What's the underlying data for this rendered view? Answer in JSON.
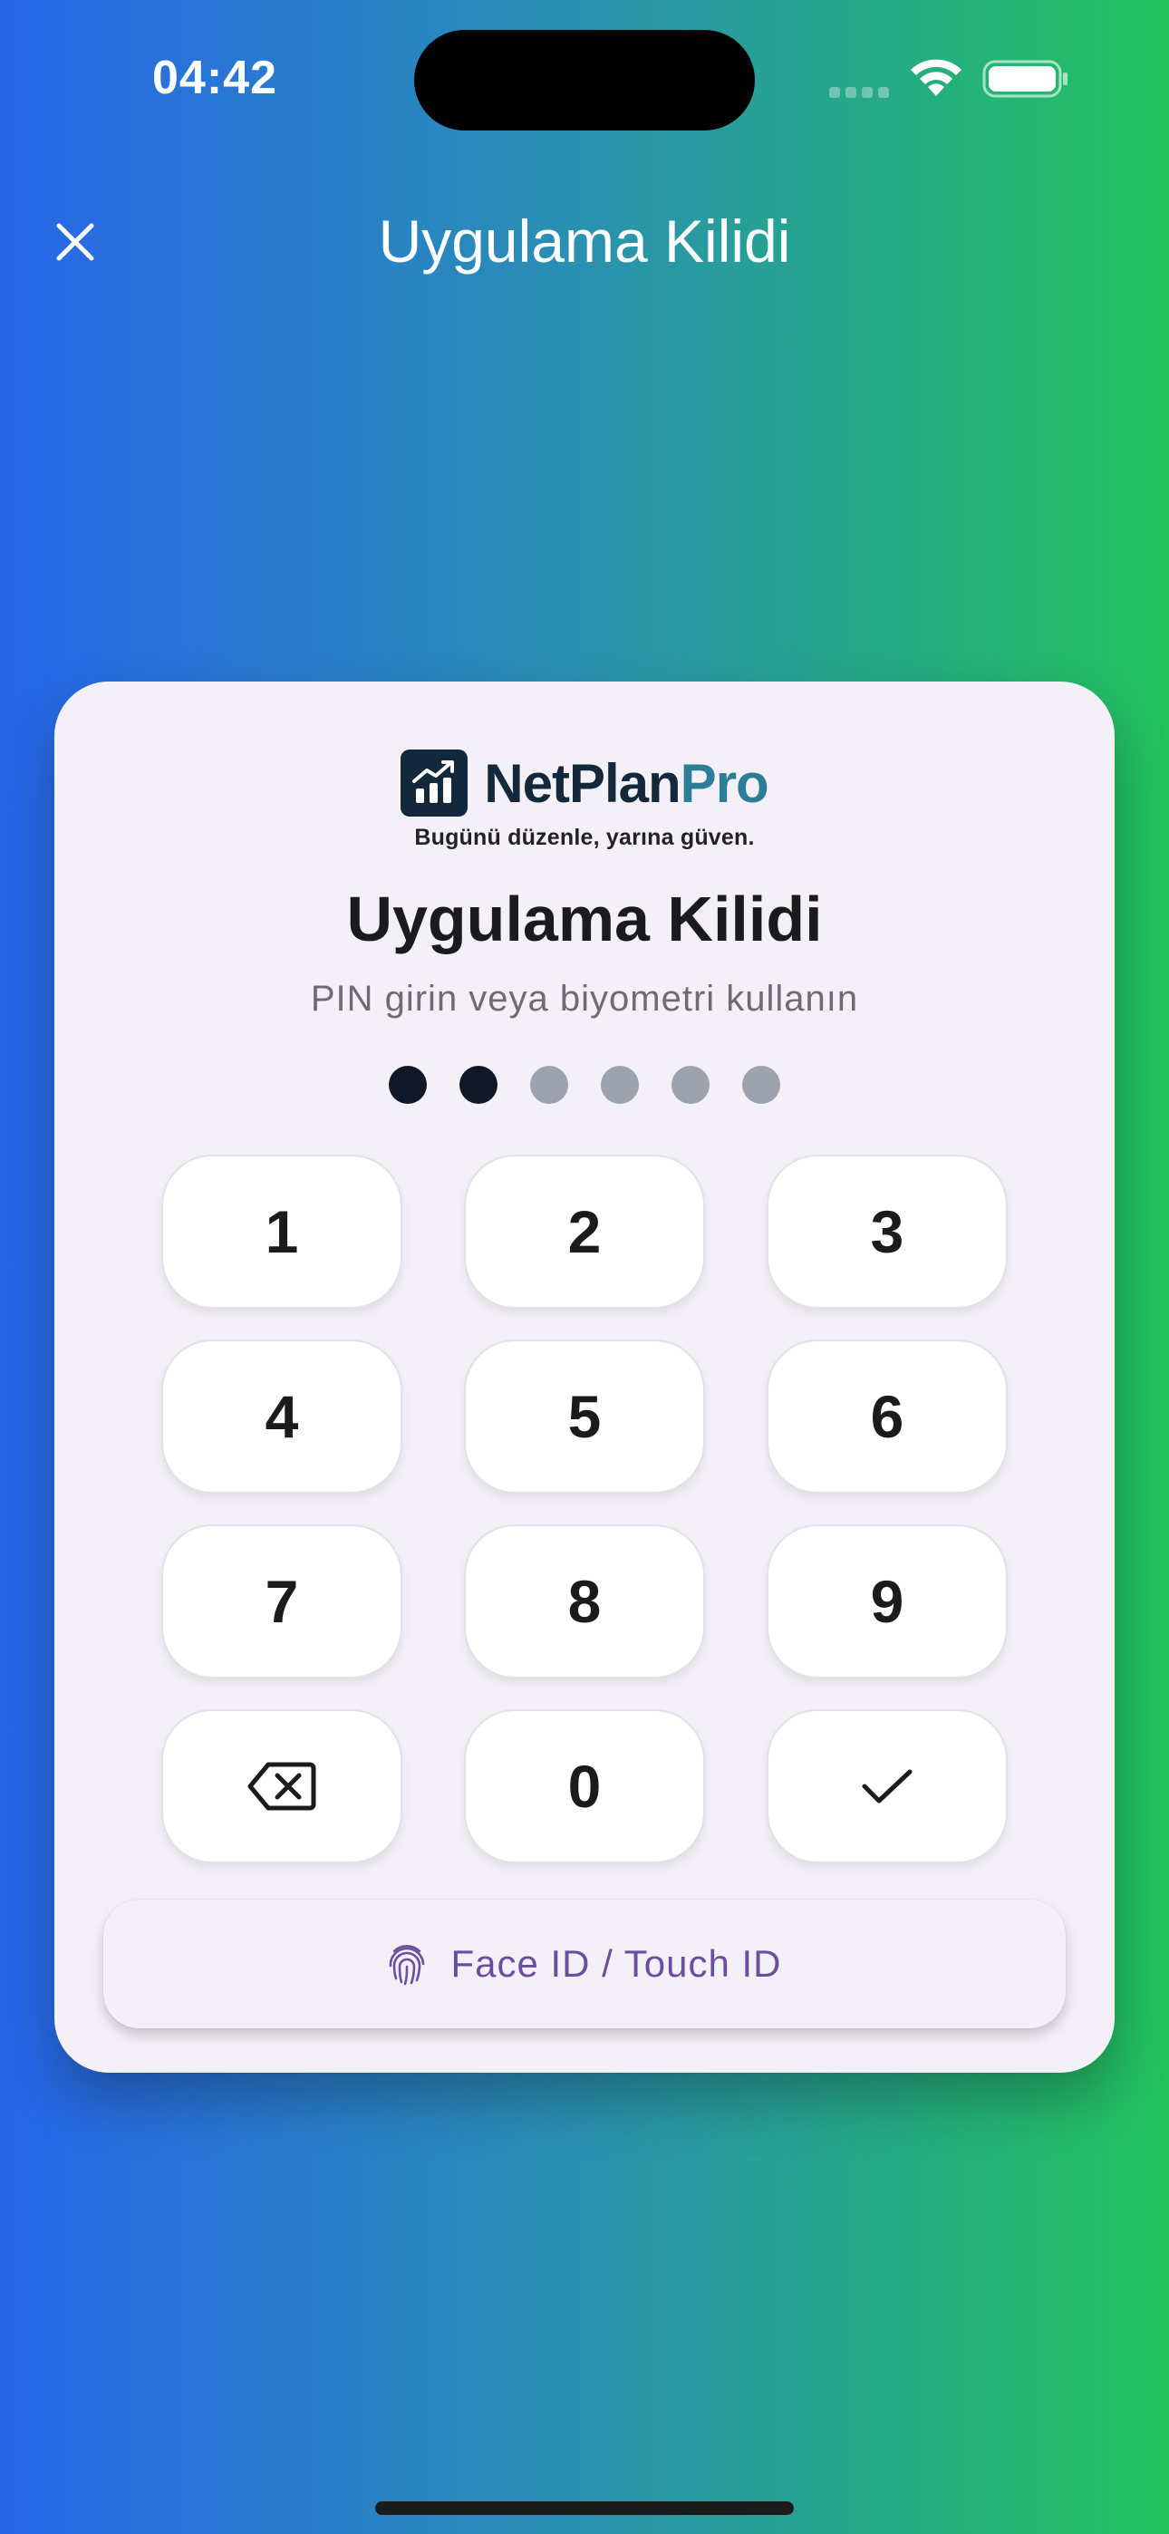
{
  "status_bar": {
    "time": "04:42"
  },
  "header": {
    "title": "Uygulama Kilidi"
  },
  "brand": {
    "name_part1": "NetPlan",
    "name_part2": "Pro",
    "tagline": "Bugünü düzenle, yarına güven."
  },
  "lock": {
    "title": "Uygulama Kilidi",
    "subtitle": "PIN girin veya biyometri kullanın",
    "pin_length": 6,
    "pin_filled": 2
  },
  "keypad": {
    "keys": [
      "1",
      "2",
      "3",
      "4",
      "5",
      "6",
      "7",
      "8",
      "9",
      "backspace-icon",
      "0",
      "check-icon"
    ]
  },
  "biometric": {
    "label": "Face ID / Touch ID",
    "icon": "fingerprint-icon"
  },
  "colors": {
    "gradient_start": "#2766ea",
    "gradient_end": "#22c25d",
    "card_bg": "#f4f0f7",
    "dot_filled": "#101827",
    "dot_empty": "#9ca3af",
    "biometric_text": "#6a4fa0",
    "brand_dark": "#14283c",
    "brand_accent": "#2d7d96"
  }
}
